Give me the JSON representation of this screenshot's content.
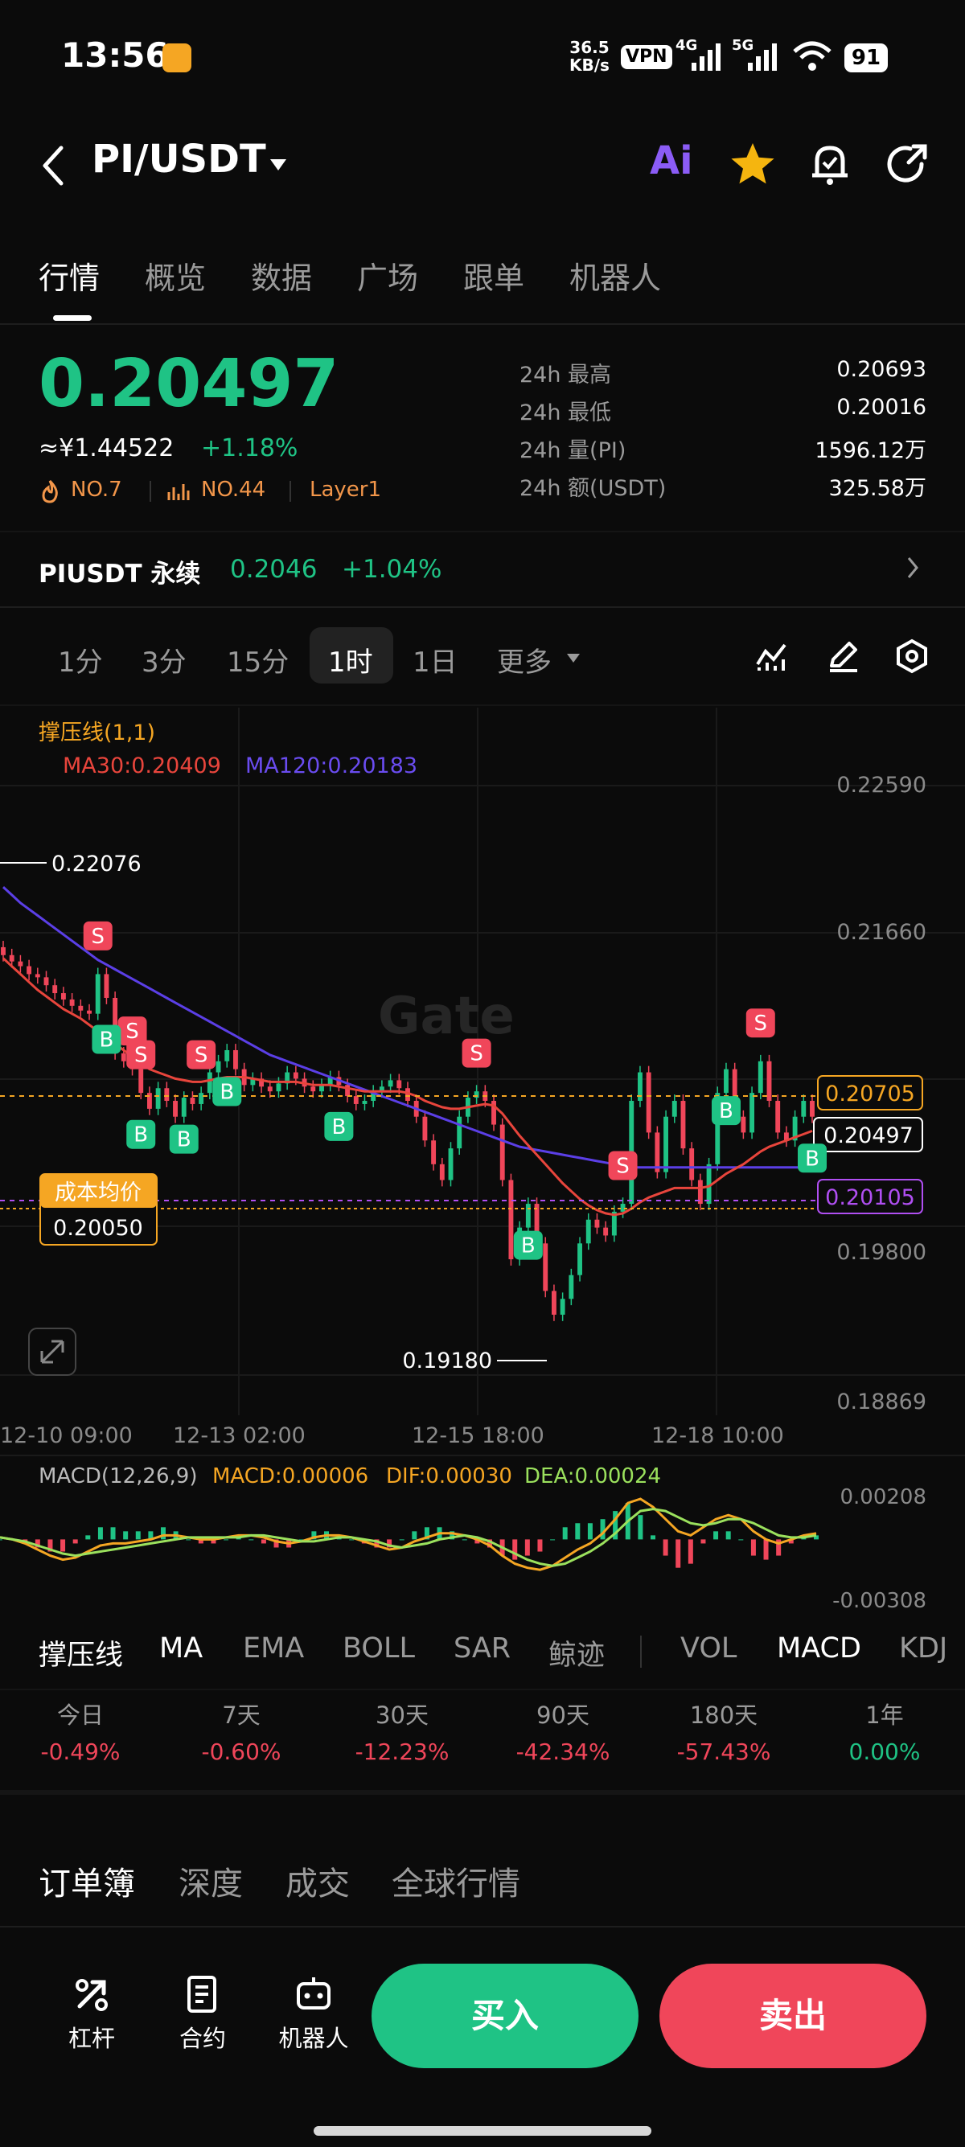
{
  "status_bar": {
    "time": "13:56",
    "net_speed_value": "36.5",
    "net_speed_unit": "KB/s",
    "vpn": "VPN",
    "sig_4g": "4G",
    "sig_5g": "5G",
    "battery": "91"
  },
  "header": {
    "pair": "PI/USDT",
    "ai_label": "Ai"
  },
  "tabs": [
    "行情",
    "概览",
    "数据",
    "广场",
    "跟单",
    "机器人"
  ],
  "ticker": {
    "price": "0.20497",
    "cny": "≈¥1.44522",
    "change": "+1.18%",
    "rank1": "NO.7",
    "rank2": "NO.44",
    "sector": "Layer1",
    "stats": [
      {
        "label": "24h  最高",
        "value": "0.20693"
      },
      {
        "label": "24h  最低",
        "value": "0.20016"
      },
      {
        "label": "24h  量(PI)",
        "value": "1596.12万"
      },
      {
        "label": "24h  额(USDT)",
        "value": "325.58万"
      }
    ]
  },
  "perpetual": {
    "name": "PIUSDT 永续",
    "price": "0.2046",
    "change": "+1.04%"
  },
  "intervals": {
    "items": [
      "1分",
      "3分",
      "15分",
      "1时",
      "1日"
    ],
    "more": "更多",
    "active": "1时"
  },
  "chart": {
    "indicator_title": "撑压线(1,1)",
    "ma30": "MA30:0.20409",
    "ma120": "MA120:0.20183",
    "watermark": "Gate",
    "y_ticks": [
      "0.22590",
      "0.21660",
      "0.20705",
      "0.19800",
      "0.18869"
    ],
    "x_ticks": [
      "12-10 09:00",
      "12-13 02:00",
      "12-15 18:00",
      "12-18 10:00"
    ],
    "high_label": "0.22076",
    "low_label": "0.19180",
    "resistance": "0.20705",
    "last_price": "0.20497",
    "support": "0.20105",
    "cost_label": "成本均价",
    "cost_value": "0.20050",
    "macd_title": "MACD(12,26,9)",
    "macd_val": "MACD:0.00006",
    "dif_val": "DIF:0.00030",
    "dea_val": "DEA:0.00024",
    "macd_ticks": [
      "0.00208",
      "-0.00308"
    ],
    "colors": {
      "up": "#1fc385",
      "down": "#f0465a",
      "ma30": "#e8453c",
      "ma120": "#5b3fe6",
      "resistance": "#f5a623",
      "support": "#b04ff2"
    }
  },
  "chart_data": {
    "type": "candlestick",
    "interval": "1时",
    "x_ticks": [
      "12-10 09:00",
      "12-13 02:00",
      "12-15 18:00",
      "12-18 10:00"
    ],
    "ylim": [
      0.18869,
      0.2259
    ],
    "y_ticks": [
      0.2259,
      0.2166,
      0.20705,
      0.198,
      0.18869
    ],
    "close": [
      0.2152,
      0.2148,
      0.2145,
      0.214,
      0.2138,
      0.2133,
      0.2128,
      0.2124,
      0.212,
      0.2117,
      0.2115,
      0.214,
      0.2125,
      0.209,
      0.2085,
      0.208,
      0.2065,
      0.2055,
      0.2068,
      0.206,
      0.205,
      0.2062,
      0.2058,
      0.2065,
      0.2078,
      0.2085,
      0.2092,
      0.208,
      0.207,
      0.2074,
      0.2069,
      0.2066,
      0.2071,
      0.2078,
      0.2074,
      0.2069,
      0.2066,
      0.207,
      0.2075,
      0.207,
      0.2063,
      0.2058,
      0.206,
      0.2066,
      0.2069,
      0.2073,
      0.2068,
      0.206,
      0.205,
      0.2035,
      0.202,
      0.201,
      0.203,
      0.205,
      0.2062,
      0.2066,
      0.206,
      0.2045,
      0.201,
      0.196,
      0.198,
      0.1995,
      0.197,
      0.194,
      0.1925,
      0.1935,
      0.195,
      0.197,
      0.1985,
      0.198,
      0.1975,
      0.199,
      0.1995,
      0.206,
      0.2078,
      0.204,
      0.2015,
      0.205,
      0.206,
      0.203,
      0.201,
      0.1995,
      0.202,
      0.2065,
      0.208,
      0.205,
      0.204,
      0.2065,
      0.2085,
      0.206,
      0.204,
      0.2035,
      0.205,
      0.206,
      0.205
    ],
    "ma30": [
      0.215,
      0.2145,
      0.214,
      0.2135,
      0.213,
      0.2126,
      0.2122,
      0.2118,
      0.2115,
      0.2112,
      0.2108,
      0.2104,
      0.21,
      0.2096,
      0.2092,
      0.2088,
      0.2084,
      0.208,
      0.2078,
      0.2076,
      0.2074,
      0.2073,
      0.2072,
      0.2072,
      0.2073,
      0.2074,
      0.2075,
      0.2075,
      0.2075,
      0.2074,
      0.2073,
      0.2072,
      0.2072,
      0.2072,
      0.2072,
      0.2071,
      0.207,
      0.207,
      0.207,
      0.2069,
      0.2068,
      0.2067,
      0.2066,
      0.2066,
      0.2066,
      0.2066,
      0.2066,
      0.2065,
      0.2063,
      0.206,
      0.2058,
      0.2056,
      0.2055,
      0.2055,
      0.2056,
      0.2057,
      0.2058,
      0.2057,
      0.2052,
      0.2045,
      0.2038,
      0.2032,
      0.2026,
      0.202,
      0.2014,
      0.2008,
      0.2003,
      0.1998,
      0.1994,
      0.1991,
      0.1989,
      0.1988,
      0.1989,
      0.1992,
      0.1996,
      0.1999,
      0.2001,
      0.2003,
      0.2005,
      0.2005,
      0.2005,
      0.2005,
      0.2006,
      0.201,
      0.2014,
      0.2017,
      0.202,
      0.2024,
      0.2028,
      0.2031,
      0.2033,
      0.2035,
      0.2037,
      0.2039,
      0.2041
    ],
    "ma120": [
      0.2195,
      0.219,
      0.2185,
      0.2181,
      0.2177,
      0.2173,
      0.2169,
      0.2165,
      0.2161,
      0.2157,
      0.2153,
      0.2149,
      0.2146,
      0.2143,
      0.214,
      0.2137,
      0.2134,
      0.2131,
      0.2128,
      0.2125,
      0.2122,
      0.2119,
      0.2116,
      0.2113,
      0.211,
      0.2107,
      0.2104,
      0.2101,
      0.2098,
      0.2095,
      0.2092,
      0.2089,
      0.2087,
      0.2085,
      0.2083,
      0.2081,
      0.2079,
      0.2077,
      0.2075,
      0.2073,
      0.2071,
      0.2069,
      0.2067,
      0.2065,
      0.2063,
      0.2061,
      0.2059,
      0.2057,
      0.2055,
      0.2053,
      0.2051,
      0.2049,
      0.2047,
      0.2045,
      0.2043,
      0.2041,
      0.2039,
      0.2037,
      0.2035,
      0.2033,
      0.2031,
      0.203,
      0.2029,
      0.2028,
      0.2027,
      0.2026,
      0.2025,
      0.2024,
      0.2023,
      0.2022,
      0.2021,
      0.202,
      0.2019,
      0.2018,
      0.2018,
      0.2018,
      0.2018,
      0.2018,
      0.2018,
      0.2018,
      0.2018,
      0.2018,
      0.2018,
      0.2018,
      0.2018,
      0.2018,
      0.2018,
      0.2018,
      0.2018,
      0.2018,
      0.2018,
      0.2018,
      0.2018,
      0.2018,
      0.2018
    ],
    "signals": [
      {
        "type": "S",
        "idx": 11
      },
      {
        "type": "S",
        "idx": 15
      },
      {
        "type": "S",
        "idx": 16
      },
      {
        "type": "S",
        "idx": 23
      },
      {
        "type": "B",
        "idx": 12
      },
      {
        "type": "B",
        "idx": 16
      },
      {
        "type": "B",
        "idx": 21
      },
      {
        "type": "B",
        "idx": 26
      },
      {
        "type": "B",
        "idx": 39
      },
      {
        "type": "S",
        "idx": 55
      },
      {
        "type": "B",
        "idx": 61
      },
      {
        "type": "S",
        "idx": 72
      },
      {
        "type": "S",
        "idx": 88
      },
      {
        "type": "B",
        "idx": 84
      },
      {
        "type": "B",
        "idx": 96
      }
    ],
    "macd_ylim": [
      -0.00308,
      0.00208
    ],
    "dif": [
      0.0001,
      0.0,
      -0.0002,
      -0.0005,
      -0.0008,
      -0.001,
      -0.0009,
      -0.0006,
      -0.0003,
      -0.0002,
      -0.0002,
      -0.0001,
      0.0,
      0.0002,
      0.0002,
      0.0001,
      0.0,
      0.0,
      0.0001,
      0.0002,
      0.0002,
      0.0001,
      -0.0001,
      -0.0002,
      -0.0001,
      0.0001,
      0.0002,
      0.0002,
      0.0001,
      -0.0001,
      -0.0003,
      -0.0005,
      -0.0004,
      -0.0001,
      0.0001,
      0.0003,
      0.0003,
      0.0002,
      0.0,
      -0.0003,
      -0.0008,
      -0.0012,
      -0.0014,
      -0.0015,
      -0.0013,
      -0.0009,
      -0.0005,
      -0.0002,
      0.0003,
      0.001,
      0.0018,
      0.002,
      0.0016,
      0.001,
      0.0004,
      0.0002,
      0.0006,
      0.001,
      0.0012,
      0.001,
      0.0004,
      0.0,
      -0.0002,
      0.0,
      0.0002,
      0.0003
    ],
    "dea": [
      0.0001,
      0.0,
      -0.0001,
      -0.0003,
      -0.0005,
      -0.0007,
      -0.0008,
      -0.0007,
      -0.0006,
      -0.0005,
      -0.0004,
      -0.0003,
      -0.0002,
      -0.0001,
      0.0,
      0.0001,
      0.0001,
      0.0001,
      0.0001,
      0.0001,
      0.0002,
      0.0002,
      0.0001,
      0.0,
      -0.0001,
      -0.0001,
      0.0,
      0.0001,
      0.0001,
      0.0,
      -0.0001,
      -0.0003,
      -0.0004,
      -0.0003,
      -0.0002,
      0.0,
      0.0001,
      0.0002,
      0.0001,
      -0.0001,
      -0.0004,
      -0.0007,
      -0.001,
      -0.0012,
      -0.0013,
      -0.0012,
      -0.0009,
      -0.0006,
      -0.0002,
      0.0003,
      0.0009,
      0.0014,
      0.0015,
      0.0014,
      0.0011,
      0.0008,
      0.0007,
      0.0008,
      0.001,
      0.001,
      0.0008,
      0.0005,
      0.0002,
      0.0001,
      0.0001,
      0.0002
    ]
  },
  "indicators": [
    "撑压线",
    "MA",
    "EMA",
    "BOLL",
    "SAR",
    "鲸迹",
    "VOL",
    "MACD",
    "KDJ"
  ],
  "indicators_on": [
    "撑压线",
    "MA",
    "MACD"
  ],
  "performance": [
    {
      "label": "今日",
      "value": "-0.49%"
    },
    {
      "label": "7天",
      "value": "-0.60%"
    },
    {
      "label": "30天",
      "value": "-12.23%"
    },
    {
      "label": "90天",
      "value": "-42.34%"
    },
    {
      "label": "180天",
      "value": "-57.43%"
    },
    {
      "label": "1年",
      "value": "0.00%"
    }
  ],
  "book_tabs": [
    "订单簿",
    "深度",
    "成交",
    "全球行情"
  ],
  "bottom": {
    "leverage": "杠杆",
    "contract": "合约",
    "robot": "机器人",
    "buy": "买入",
    "sell": "卖出"
  }
}
